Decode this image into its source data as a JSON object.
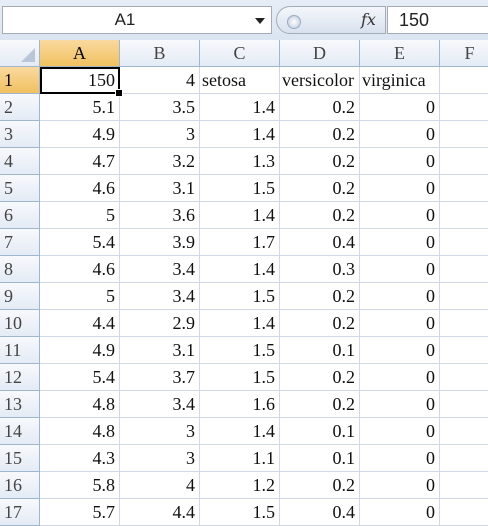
{
  "formula_bar": {
    "name_box": "A1",
    "fx_label": "fx",
    "formula_value": "150"
  },
  "columns": [
    "A",
    "B",
    "C",
    "D",
    "E",
    "F"
  ],
  "rows": [
    {
      "num": "1",
      "cells": [
        "150",
        "4",
        "setosa",
        "versicolor",
        "virginica"
      ]
    },
    {
      "num": "2",
      "cells": [
        "5.1",
        "3.5",
        "1.4",
        "0.2",
        "0"
      ]
    },
    {
      "num": "3",
      "cells": [
        "4.9",
        "3",
        "1.4",
        "0.2",
        "0"
      ]
    },
    {
      "num": "4",
      "cells": [
        "4.7",
        "3.2",
        "1.3",
        "0.2",
        "0"
      ]
    },
    {
      "num": "5",
      "cells": [
        "4.6",
        "3.1",
        "1.5",
        "0.2",
        "0"
      ]
    },
    {
      "num": "6",
      "cells": [
        "5",
        "3.6",
        "1.4",
        "0.2",
        "0"
      ]
    },
    {
      "num": "7",
      "cells": [
        "5.4",
        "3.9",
        "1.7",
        "0.4",
        "0"
      ]
    },
    {
      "num": "8",
      "cells": [
        "4.6",
        "3.4",
        "1.4",
        "0.3",
        "0"
      ]
    },
    {
      "num": "9",
      "cells": [
        "5",
        "3.4",
        "1.5",
        "0.2",
        "0"
      ]
    },
    {
      "num": "10",
      "cells": [
        "4.4",
        "2.9",
        "1.4",
        "0.2",
        "0"
      ]
    },
    {
      "num": "11",
      "cells": [
        "4.9",
        "3.1",
        "1.5",
        "0.1",
        "0"
      ]
    },
    {
      "num": "12",
      "cells": [
        "5.4",
        "3.7",
        "1.5",
        "0.2",
        "0"
      ]
    },
    {
      "num": "13",
      "cells": [
        "4.8",
        "3.4",
        "1.6",
        "0.2",
        "0"
      ]
    },
    {
      "num": "14",
      "cells": [
        "4.8",
        "3",
        "1.4",
        "0.1",
        "0"
      ]
    },
    {
      "num": "15",
      "cells": [
        "4.3",
        "3",
        "1.1",
        "0.1",
        "0"
      ]
    },
    {
      "num": "16",
      "cells": [
        "5.8",
        "4",
        "1.2",
        "0.2",
        "0"
      ]
    },
    {
      "num": "17",
      "cells": [
        "5.7",
        "4.4",
        "1.5",
        "0.4",
        "0"
      ]
    }
  ],
  "text_cells": [
    "0-2",
    "0-3",
    "0-4"
  ],
  "selected_column": "A",
  "selected_row": "1"
}
